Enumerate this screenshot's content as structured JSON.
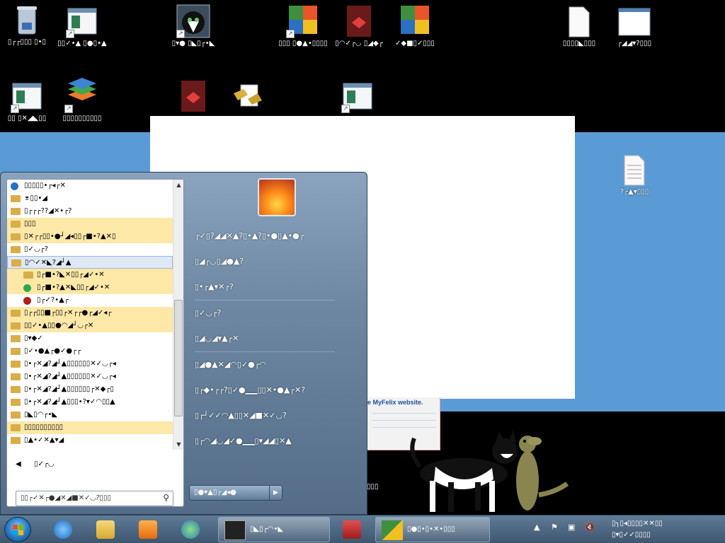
{
  "desktop": {
    "icons": [
      {
        "id": "recycle",
        "label": "▯┌┌▯▯▯ ▯•▯"
      },
      {
        "id": "app1",
        "label": "▯▯✓•▲ ▯●▯•▲"
      },
      {
        "id": "cat",
        "label": "▯▾● ▯◣▯┌•◣"
      },
      {
        "id": "avg1",
        "label": "▯▯▯ ▯●▲•▯▯▯▯"
      },
      {
        "id": "red1",
        "label": "▯◠✓┌◡ ▯◢◆┌"
      },
      {
        "id": "avg2",
        "label": "✓◆■▯✓▯▯▯"
      },
      {
        "id": "doc1",
        "label": "▯▯▯▯◣▯▯▯"
      },
      {
        "id": "win1",
        "label": "┌◢◢▾?▯▯▯"
      },
      {
        "id": "app2",
        "label": "▯▯ ▯✕◢◣▯▯"
      },
      {
        "id": "stack",
        "label": "▯▯▯▯▯▯▯▯▯▯"
      },
      {
        "id": "txt1",
        "label": "?┌▲▾▯▯▯"
      }
    ],
    "popup_link": "e MyFelix website.",
    "partial_label": "▯▯▯"
  },
  "start_menu": {
    "programs": [
      {
        "label": "▯▯▯▯▯•┌◂┌✕",
        "type": "app",
        "hl": false
      },
      {
        "label": "⌆▯▯•◢",
        "type": "folder",
        "hl": false
      },
      {
        "label": "▯┌┌┌??◢✕•┌?",
        "type": "folder",
        "hl": false
      },
      {
        "label": "▯▯▯",
        "type": "folder",
        "hl": true
      },
      {
        "label": "▯✕┌┌▯▯•●┘◢◂▯▯┌■•?▲✕▯",
        "type": "folder",
        "hl": true
      },
      {
        "label": "▯✓◡┌?",
        "type": "folder",
        "hl": false
      },
      {
        "label": "▯◠✓✕◣?◢┘▲",
        "type": "folder",
        "hl": false,
        "sel": true
      },
      {
        "label": "▯┌■•?◣✕▯▯┌◢✓•✕",
        "type": "folder",
        "hl": true,
        "sub": true
      },
      {
        "label": "▯┌■•?▲✕◣▯▯┌◢✓•✕",
        "type": "app",
        "hl": true,
        "sub": true
      },
      {
        "label": "▯┌✓?•▲┌",
        "type": "app",
        "hl": false,
        "sub": true
      },
      {
        "label": "▯┌┌▯▯■┌▯▯┌✕┌┌●┌◢✓◂┌",
        "type": "folder",
        "hl": true
      },
      {
        "label": "▯▯✓•▲▯▯●◠◢┘◡┌✕",
        "type": "folder",
        "hl": true
      },
      {
        "label": "▯▾◆✓",
        "type": "folder",
        "hl": false
      },
      {
        "label": "▯✓•●▲┌●✓●┌┌",
        "type": "folder",
        "hl": false
      },
      {
        "label": "▯•┌✕◢?◢┘▲▯▯▯▯▯▯✕✓◡┌◂",
        "type": "folder",
        "hl": false
      },
      {
        "label": "▯•┌✕◢?◢┘▲▯▯▯▯▯▯✕✓◡┌◂",
        "type": "folder",
        "hl": false
      },
      {
        "label": "▯•┌✕◢?◢┘▲▯▯▯▯▯▯┌✕◆┌▯",
        "type": "folder",
        "hl": false
      },
      {
        "label": "▯•┌✕◢?◢┘▲▯▯▯•?▾✓◠▯▯▲",
        "type": "folder",
        "hl": false
      },
      {
        "label": "▯◣▯◠┌•◣",
        "type": "folder",
        "hl": false
      },
      {
        "label": "▯▯▯▯▯▯▯▯▯▯",
        "type": "folder",
        "hl": true
      },
      {
        "label": "▯▲•✓✕▲▾◢",
        "type": "folder",
        "hl": false
      }
    ],
    "back_label": "▯✓┌◡",
    "search_placeholder": "▯▯┌✓✕┌●◢✕◢■✕✓◡?▯▯▯",
    "right_items": [
      "┌✓▯?◢◢✕▲?▯•▲?▯•●▯▲•●┌",
      "▯◢┌◡▯◢●▲?",
      "▯•┌▲▾✕┌?",
      "---",
      "▯✓◡┌?",
      "▯◢◡◢▾▲┌✕",
      "---",
      "▯◢●▲✕◢◠▯✓●┌◠",
      "▯┌◆•┌┌?▯✓●▁▁▯▯✕•●▲┌✕?",
      "▯┌┘✓✓◠▲▯▯✕◢■✕✓◡?",
      "▯┌◠◢◡◢✓●▁▁▯▾◢◢▯✕▲"
    ],
    "shutdown_label": "▯●▾▲▯┌◢◂●"
  },
  "taskbar": {
    "tasks": [
      {
        "id": "cat",
        "label": "▯◣▯┌◠•◣"
      },
      {
        "id": "avg",
        "label": "▯●▯•▯•✕•▯▯▯"
      }
    ],
    "clock_line1": "▯┐▯◂▯▯▯▯✕✕▯▯",
    "clock_line2": "▯▾▯✓✓▯▯▯▯",
    "clock_line3": "▯▯▯◂▯▯▯▯▯▯▯"
  }
}
